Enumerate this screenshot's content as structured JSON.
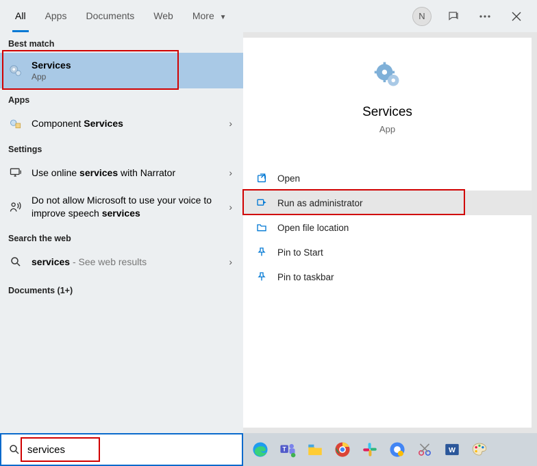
{
  "tabs": {
    "all": "All",
    "apps": "Apps",
    "documents": "Documents",
    "web": "Web",
    "more": "More"
  },
  "user_initial": "N",
  "left": {
    "best_match_header": "Best match",
    "best_match": {
      "title": "Services",
      "sub": "App"
    },
    "apps_header": "Apps",
    "apps_row_prefix": "Component ",
    "apps_row_bold": "Services",
    "settings_header": "Settings",
    "setting1_prefix": "Use online ",
    "setting1_bold": "services",
    "setting1_suffix": " with Narrator",
    "setting2_prefix": "Do not allow Microsoft to use your voice to improve speech ",
    "setting2_bold": "services",
    "web_header": "Search the web",
    "web_row_bold": "services",
    "web_row_suffix": " - See web results",
    "docs_header": "Documents (1+)"
  },
  "right": {
    "title": "Services",
    "sub": "App",
    "actions": {
      "open": "Open",
      "run_admin": "Run as administrator",
      "open_loc": "Open file location",
      "pin_start": "Pin to Start",
      "pin_taskbar": "Pin to taskbar"
    }
  },
  "search": {
    "value": "services"
  }
}
